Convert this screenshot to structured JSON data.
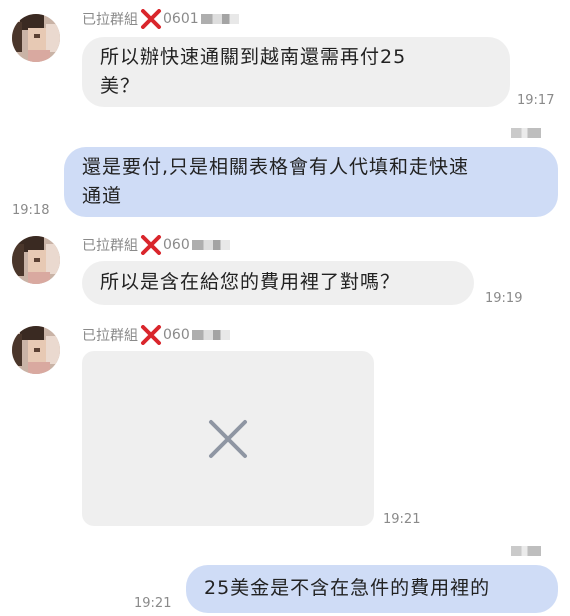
{
  "conversation": {
    "messages": [
      {
        "direction": "incoming",
        "sender_label": "已拉群組",
        "sender_id_partial": "0601",
        "text_line1": "所以辦快速通關到越南還需再付25",
        "text_line2": "美？",
        "time": "19:17"
      },
      {
        "direction": "outgoing",
        "text_line1": "還是要付,只是相關表格會有人代填和走快速",
        "text_line2": "通道",
        "time": "19:18"
      },
      {
        "direction": "incoming",
        "sender_label": "已拉群組",
        "sender_id_partial": "060",
        "text": "所以是含在給您的費用裡了對嗎？",
        "time": "19:19"
      },
      {
        "direction": "incoming",
        "sender_label": "已拉群組",
        "sender_id_partial": "060",
        "attachment": "broken-image",
        "time": "19:21"
      },
      {
        "direction": "outgoing",
        "text": "25美金是不含在急件的費用裡的",
        "time": "19:21"
      }
    ]
  },
  "colors": {
    "incoming_bubble": "#efefef",
    "outgoing_bubble": "#cfdcf6",
    "red_x_mark": "#d9262c",
    "broken_image_icon": "#8f96a3",
    "meta_text": "#8a8a8a"
  },
  "icons": {
    "sender_mark": "red-x-icon",
    "image_placeholder": "broken-image-x-icon"
  }
}
